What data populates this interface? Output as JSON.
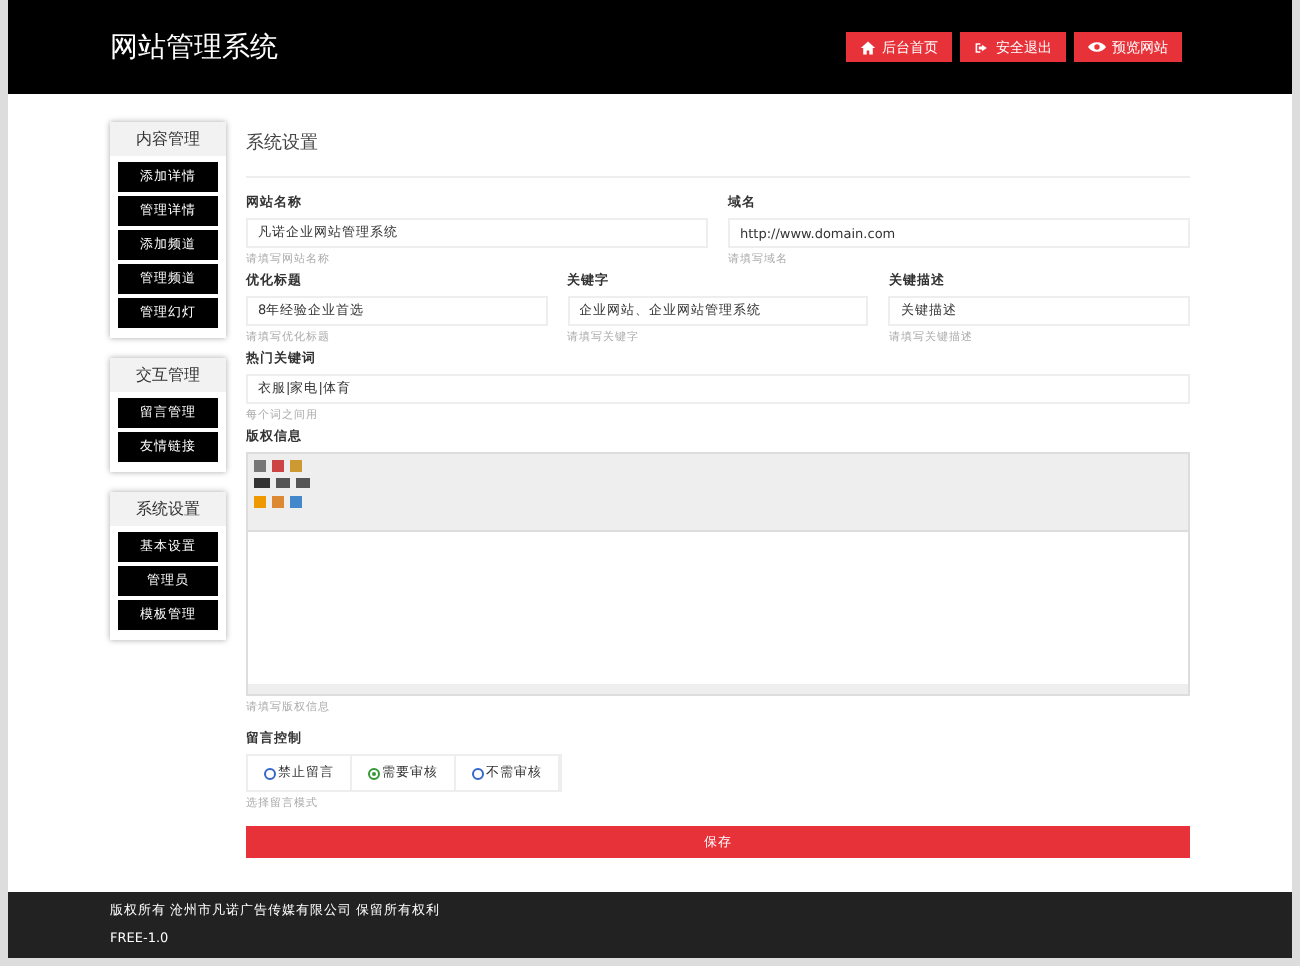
{
  "header": {
    "title": "网站管理系统",
    "buttons": [
      {
        "kind": "home",
        "label": "后台首页"
      },
      {
        "kind": "logout",
        "label": "安全退出"
      },
      {
        "kind": "preview",
        "label": "预览网站"
      }
    ]
  },
  "sidebar": [
    {
      "title": "内容管理",
      "items": [
        "添加详情",
        "管理详情",
        "添加频道",
        "管理频道",
        "管理幻灯"
      ]
    },
    {
      "title": "交互管理",
      "items": [
        "留言管理",
        "友情链接"
      ]
    },
    {
      "title": "系统设置",
      "items": [
        "基本设置",
        "管理员",
        "模板管理"
      ]
    }
  ],
  "page_title": "系统设置",
  "rows": [
    [
      {
        "label": "网站名称",
        "value": "凡诺企业网站管理系统",
        "hint": "请填写网站名称"
      },
      {
        "label": "域名",
        "value": "http://www.domain.com",
        "hint": "请填写域名"
      }
    ],
    [
      {
        "label": "优化标题",
        "value": "8年经验企业首选",
        "hint": "请填写优化标题"
      },
      {
        "label": "关键字",
        "value": "企业网站、企业网站管理系统",
        "hint": "请填写关键字"
      },
      {
        "label": "关键描述",
        "value": "关键描述",
        "hint": "请填写关键描述"
      }
    ],
    [
      {
        "label": "热门关键词",
        "value": "衣服|家电|体育",
        "hint": "每个词之间用"
      }
    ]
  ],
  "editor": {
    "label": "版权信息",
    "hint": "请填写版权信息"
  },
  "message_control": {
    "label": "留言控制",
    "options": [
      {
        "label": "禁止留言",
        "selected": false
      },
      {
        "label": "需要审核",
        "selected": true
      },
      {
        "label": "不需审核",
        "selected": false
      }
    ],
    "hint": "选择留言模式"
  },
  "save_label": "保存",
  "footer": {
    "copyright": "版权所有 沧州市凡诺广告传媒有限公司 保留所有权利",
    "version": "FREE-1.0"
  }
}
